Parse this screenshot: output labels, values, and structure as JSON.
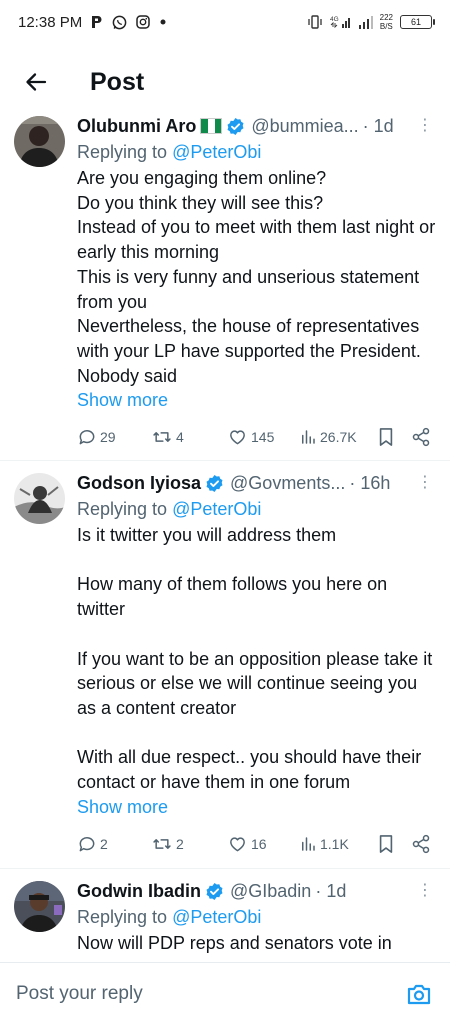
{
  "status_bar": {
    "time": "12:38 PM",
    "icons": [
      "p-app-icon",
      "whatsapp-icon",
      "instagram-icon",
      "dot-icon"
    ],
    "network": "4G",
    "net_speed_value": "222",
    "net_speed_unit": "B/S",
    "battery": "61"
  },
  "header": {
    "title": "Post"
  },
  "tweets": [
    {
      "name": "Olubunmi Aro",
      "has_flag": true,
      "handle": "@bummiea...",
      "time": "· 1d",
      "reply_prefix": "Replying to ",
      "reply_to": "@PeterObi",
      "text": "Are you engaging them online?\nDo you think they will see this?\nInstead of you to meet with them last night or early this morning\nThis is very funny and unserious statement from you\nNevertheless, the house of representatives with your LP have supported the President. Nobody said",
      "show_more": "Show more",
      "replies": "29",
      "retweets": "4",
      "likes": "145",
      "views": "26.7K"
    },
    {
      "name": "Godson Iyiosa",
      "has_flag": false,
      "handle": "@Govments...",
      "time": "· 16h",
      "reply_prefix": "Replying to ",
      "reply_to": "@PeterObi",
      "text": "Is it twitter you will address them\n\nHow many of them follows you here on twitter\n\nIf you want to be an opposition please take it serious or else we will continue seeing you as a content creator\n\nWith all due respect.. you should have their contact or have them in one forum",
      "show_more": "Show more",
      "replies": "2",
      "retweets": "2",
      "likes": "16",
      "views": "1.1K"
    },
    {
      "name": "Godwin Ibadin",
      "has_flag": false,
      "handle": "@GIbadin",
      "time": "· 1d",
      "reply_prefix": "Replying to ",
      "reply_to": "@PeterObi",
      "text": "Now will PDP reps and senators vote in",
      "show_more": "",
      "replies": "",
      "retweets": "",
      "likes": "",
      "views": ""
    }
  ],
  "reply_bar": {
    "placeholder": "Post your reply"
  },
  "colors": {
    "accent": "#1d9bf0",
    "secondary_text": "#536471",
    "primary_text": "#0f1419"
  }
}
